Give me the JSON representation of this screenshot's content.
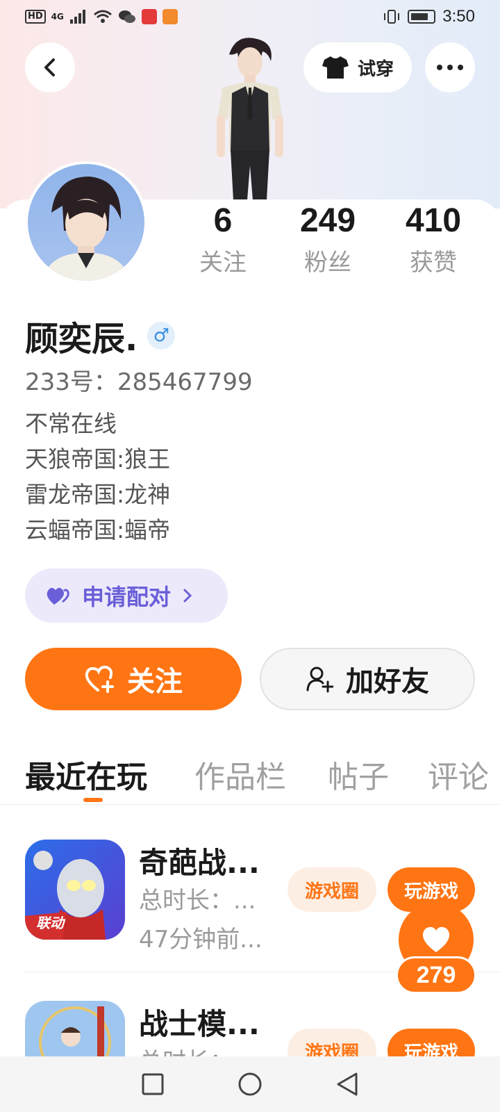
{
  "status_bar": {
    "left_icons": [
      "hd-icon",
      "signal-icon",
      "wifi-icon",
      "wechat-icon",
      "app-badge-red",
      "app-badge-orange"
    ],
    "hd": "HD",
    "network": "4G",
    "time": "3:50"
  },
  "header": {
    "back_icon": "chevron-left-icon",
    "try_on_label": "试穿",
    "more_icon": "more-dots-icon"
  },
  "profile": {
    "stats": [
      {
        "value": "6",
        "label": "关注"
      },
      {
        "value": "249",
        "label": "粉丝"
      },
      {
        "value": "410",
        "label": "获赞"
      }
    ],
    "name": "顾奕辰.",
    "gender_symbol": "♂",
    "uid": "233号：285467799",
    "bio": [
      "不常在线",
      "天狼帝国:狼王",
      "雷龙帝国:龙神",
      "云蝠帝国:蝠帝"
    ],
    "pair_label": "申请配对",
    "follow_label": "关注",
    "add_friend_label": "加好友"
  },
  "tabs": [
    {
      "label": "最近在玩",
      "active": true
    },
    {
      "label": "作品栏",
      "active": false
    },
    {
      "label": "帖子",
      "active": false
    },
    {
      "label": "评论",
      "active": false
    }
  ],
  "games": [
    {
      "title": "奇葩战...",
      "duration": "总时长：...",
      "last_played": "47分钟前...",
      "icon_badge": "联动",
      "circle_label": "游戏圈",
      "play_label": "玩游戏"
    },
    {
      "title": "战士模...",
      "duration": "总时长：...",
      "last_played": "",
      "icon_badge": "",
      "circle_label": "游戏圈",
      "play_label": "玩游戏"
    }
  ],
  "like_float": {
    "count": "279"
  },
  "nav": [
    "square-icon",
    "circle-icon",
    "triangle-back-icon"
  ],
  "colors": {
    "accent": "#ff7514",
    "pair": "#6a5fd8",
    "pair_bg": "#ece9fb"
  }
}
